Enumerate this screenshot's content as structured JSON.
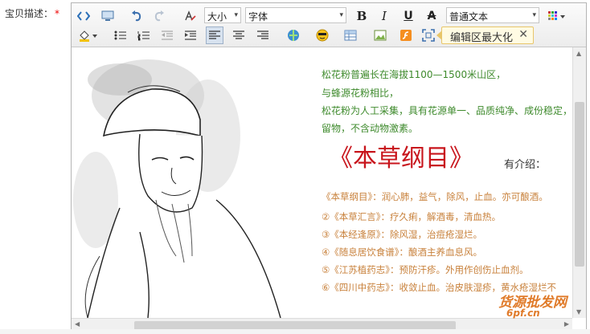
{
  "form": {
    "label": "宝贝描述：",
    "required_mark": "*"
  },
  "toolbar": {
    "font_size_label": "大小",
    "font_family_label": "字体",
    "format_label": "普通文本",
    "maximize_label": "编辑区最大化",
    "icons": [
      "source-code-icon",
      "preview-icon",
      "undo-icon",
      "redo-icon",
      "clear-format-icon",
      "bold-icon",
      "italic-icon",
      "underline-icon",
      "strikethrough-icon",
      "color-grid-icon",
      "fill-color-icon",
      "bullet-list-icon",
      "number-list-icon",
      "outdent-icon",
      "indent-icon",
      "align-left-icon",
      "align-center-icon",
      "align-right-icon",
      "link-icon",
      "emoticon-icon",
      "table-icon",
      "image-icon",
      "flash-icon",
      "fullscreen-icon",
      "close-icon"
    ]
  },
  "content": {
    "paragraphs": [
      "松花粉普遍长在海拔1100—1500米山区，",
      "与蜂源花粉相比，",
      "松花粉为人工采集，具有花源单一、品质纯净、成份稳定，",
      "留物，不含动物激素。"
    ],
    "big_title": "《本草纲目》",
    "intro_label": "有介绍：",
    "herb_notes": [
      "《本草纲目》：润心肺，益气，除风，止血。亦可酿酒。",
      "②《本草汇言》：疗久痢，解酒毒，清血热。",
      "③《本经逢原》：除风湿，治痘疮湿烂。",
      "④《随息居饮食谱》：酿酒主养血息风。",
      "⑤《江苏植药志》：预防汗疹。外用作创伤止血剂。",
      "⑥《四川中药志》：收敛止血。治皮肤湿疹，黄水疮湿烂不"
    ]
  },
  "watermark": {
    "line1": "货源批发网",
    "line2": "6pf.cn"
  },
  "colors": {
    "green_text": "#3e8a2c",
    "red_title": "#c8151c",
    "orange_text": "#c8813b",
    "highlight": "#fffbe3"
  }
}
